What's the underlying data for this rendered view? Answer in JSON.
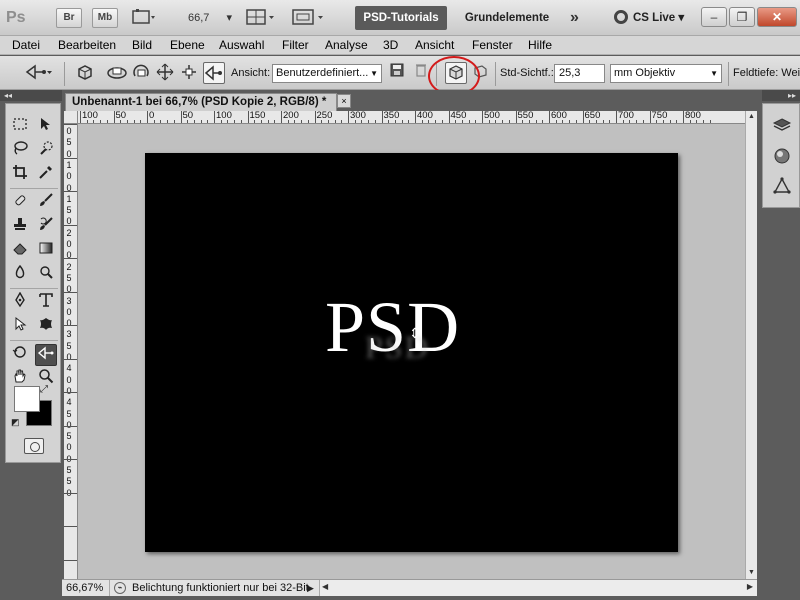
{
  "app": {
    "logo": "Ps",
    "buttons": [
      "Br",
      "Mb"
    ],
    "zoom": "66,7",
    "workspace_active": "PSD-Tutorials",
    "workspace_other": "Grundelemente",
    "more": "»",
    "cs_live": "CS Live",
    "dropdown_arrow": "▾",
    "window_controls": [
      "–",
      "❐",
      "✕"
    ]
  },
  "menu": {
    "items": [
      "Datei",
      "Bearbeiten",
      "Bild",
      "Ebene",
      "Auswahl",
      "Filter",
      "Analyse",
      "3D",
      "Ansicht",
      "Fenster",
      "Hilfe"
    ]
  },
  "options": {
    "tool_preset_icon": "camera-orbit-icon",
    "ansicht_label": "Ansicht:",
    "ansicht_value": "Benutzerdefiniert...",
    "std_sicht_label": "Std-Sichtf.:",
    "std_sicht_value": "25,3",
    "objective_value": "mm Objektiv",
    "feldtiefe_label": "Feldtiefe: Wei"
  },
  "document": {
    "tab_title": "Unbenannt-1 bei 66,7% (PSD Kopie 2, RGB/8) *",
    "close": "×",
    "canvas_text": "PSD",
    "ghost_text": "PSD",
    "ruler_h": [
      "100",
      "50",
      "0",
      "50",
      "100",
      "150",
      "200",
      "250",
      "300",
      "350",
      "400",
      "450",
      "500",
      "550",
      "600",
      "650",
      "700",
      "750",
      "800"
    ],
    "ruler_v": [
      "0",
      "5",
      "0",
      "1",
      "0",
      "0",
      "1",
      "5",
      "0",
      "2",
      "0",
      "0",
      "2",
      "5",
      "0",
      "3",
      "0",
      "0",
      "3",
      "5",
      "0",
      "4",
      "0",
      "0",
      "4",
      "5",
      "0",
      "5",
      "0",
      "0",
      "5",
      "5",
      "0"
    ]
  },
  "status": {
    "zoom": "66,67%",
    "message": "Belichtung funktioniert nur bei 32-Bit"
  },
  "panels": {
    "collapse_left": "◂◂",
    "collapse_right": "▸▸",
    "right_icons": [
      "layers-icon",
      "3d-material-icon",
      "3d-scene-icon"
    ]
  },
  "colors": {
    "foreground": "#ffffff",
    "background": "#000000",
    "highlight_circle": "#d31a1a"
  }
}
